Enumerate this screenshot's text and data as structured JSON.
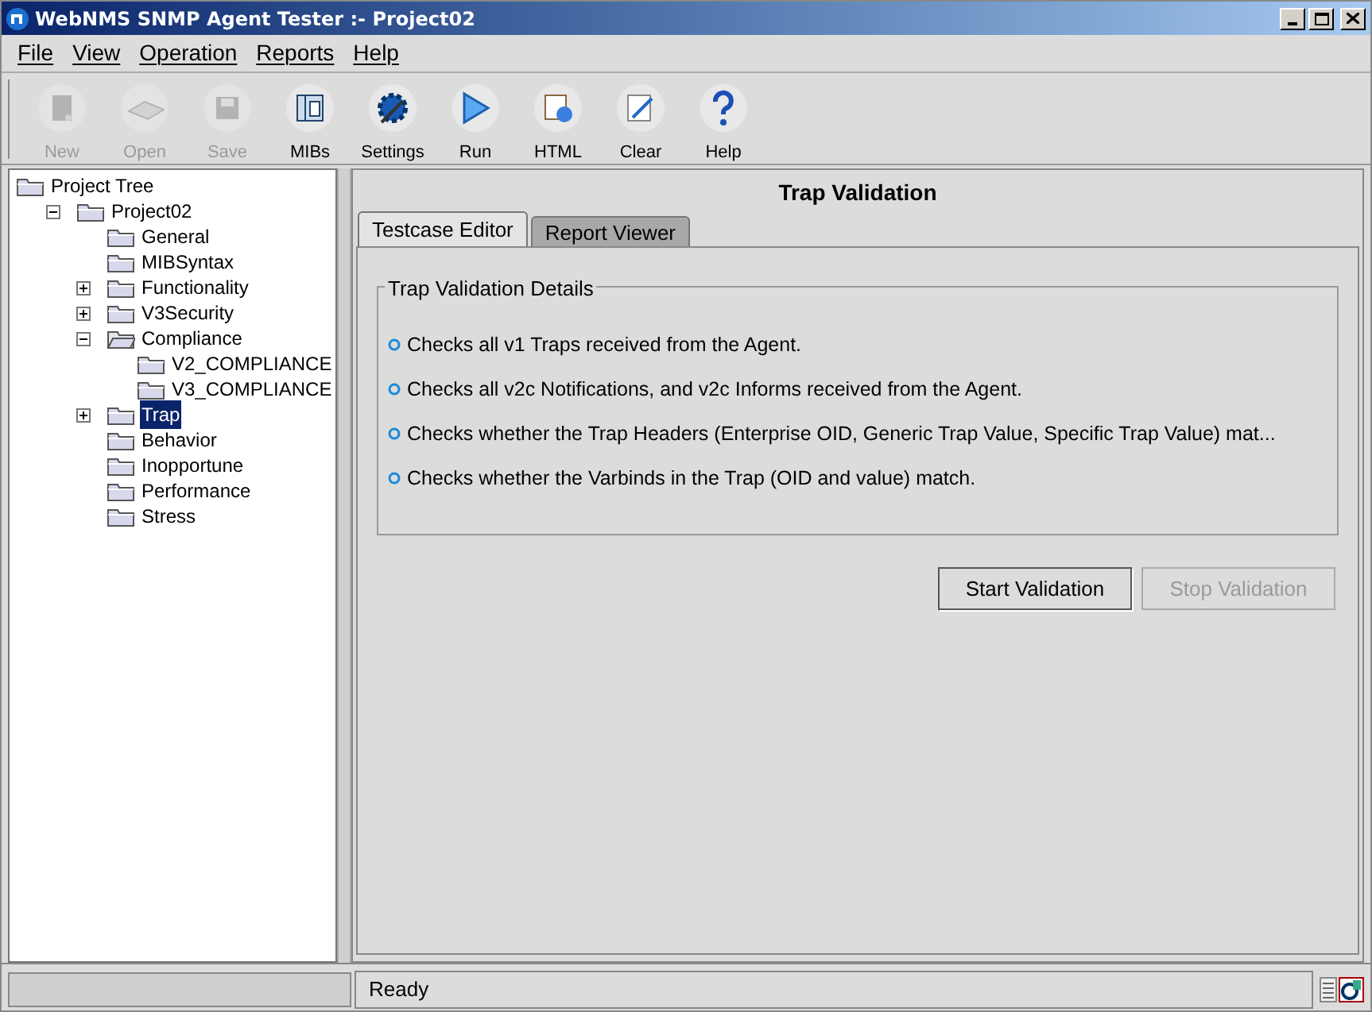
{
  "window": {
    "title": "WebNMS SNMP Agent Tester :- Project02"
  },
  "menu": [
    "File",
    "View",
    "Operation",
    "Reports",
    "Help"
  ],
  "toolbar": [
    {
      "label": "New",
      "kind": "new",
      "disabled": true
    },
    {
      "label": "Open",
      "kind": "open",
      "disabled": true
    },
    {
      "label": "Save",
      "kind": "save",
      "disabled": true
    },
    {
      "label": "MIBs",
      "kind": "mibs",
      "disabled": false
    },
    {
      "label": "Settings",
      "kind": "settings",
      "disabled": false
    },
    {
      "label": "Run",
      "kind": "run",
      "disabled": false
    },
    {
      "label": "HTML",
      "kind": "html",
      "disabled": false
    },
    {
      "label": "Clear",
      "kind": "clear",
      "disabled": false
    },
    {
      "label": "Help",
      "kind": "help",
      "disabled": false
    }
  ],
  "tree": [
    {
      "label": "Project Tree",
      "selected": false,
      "children": [
        {
          "label": "Project02",
          "selected": false,
          "expanded": true,
          "children": [
            {
              "label": "General",
              "selected": false
            },
            {
              "label": "MIBSyntax",
              "selected": false
            },
            {
              "label": "Functionality",
              "selected": false,
              "expanded": false
            },
            {
              "label": "V3Security",
              "selected": false,
              "expanded": false
            },
            {
              "label": "Compliance",
              "selected": false,
              "expanded": true,
              "children": [
                {
                  "label": "V2_COMPLIANCE",
                  "selected": false
                },
                {
                  "label": "V3_COMPLIANCE",
                  "selected": false
                }
              ]
            },
            {
              "label": "Trap",
              "selected": true,
              "expanded": false
            },
            {
              "label": "Behavior",
              "selected": false
            },
            {
              "label": "Inopportune",
              "selected": false
            },
            {
              "label": "Performance",
              "selected": false
            },
            {
              "label": "Stress",
              "selected": false
            }
          ]
        }
      ]
    }
  ],
  "panel": {
    "title": "Trap Validation",
    "tabs": [
      {
        "label": "Testcase Editor",
        "selected": true
      },
      {
        "label": "Report Viewer",
        "selected": false
      }
    ],
    "group_title": "Trap Validation Details",
    "items": [
      "Checks all v1 Traps received from the Agent.",
      "Checks all v2c Notifications, and v2c Informs received from the Agent.",
      "Checks whether the Trap Headers (Enterprise OID, Generic Trap Value, Specific Trap Value) mat...",
      "Checks whether the Varbinds in the Trap (OID and value) match."
    ],
    "buttons": [
      {
        "label": "Start Validation",
        "disabled": false
      },
      {
        "label": "Stop Validation",
        "disabled": true
      }
    ]
  },
  "status_bar": {
    "text": "Ready"
  }
}
